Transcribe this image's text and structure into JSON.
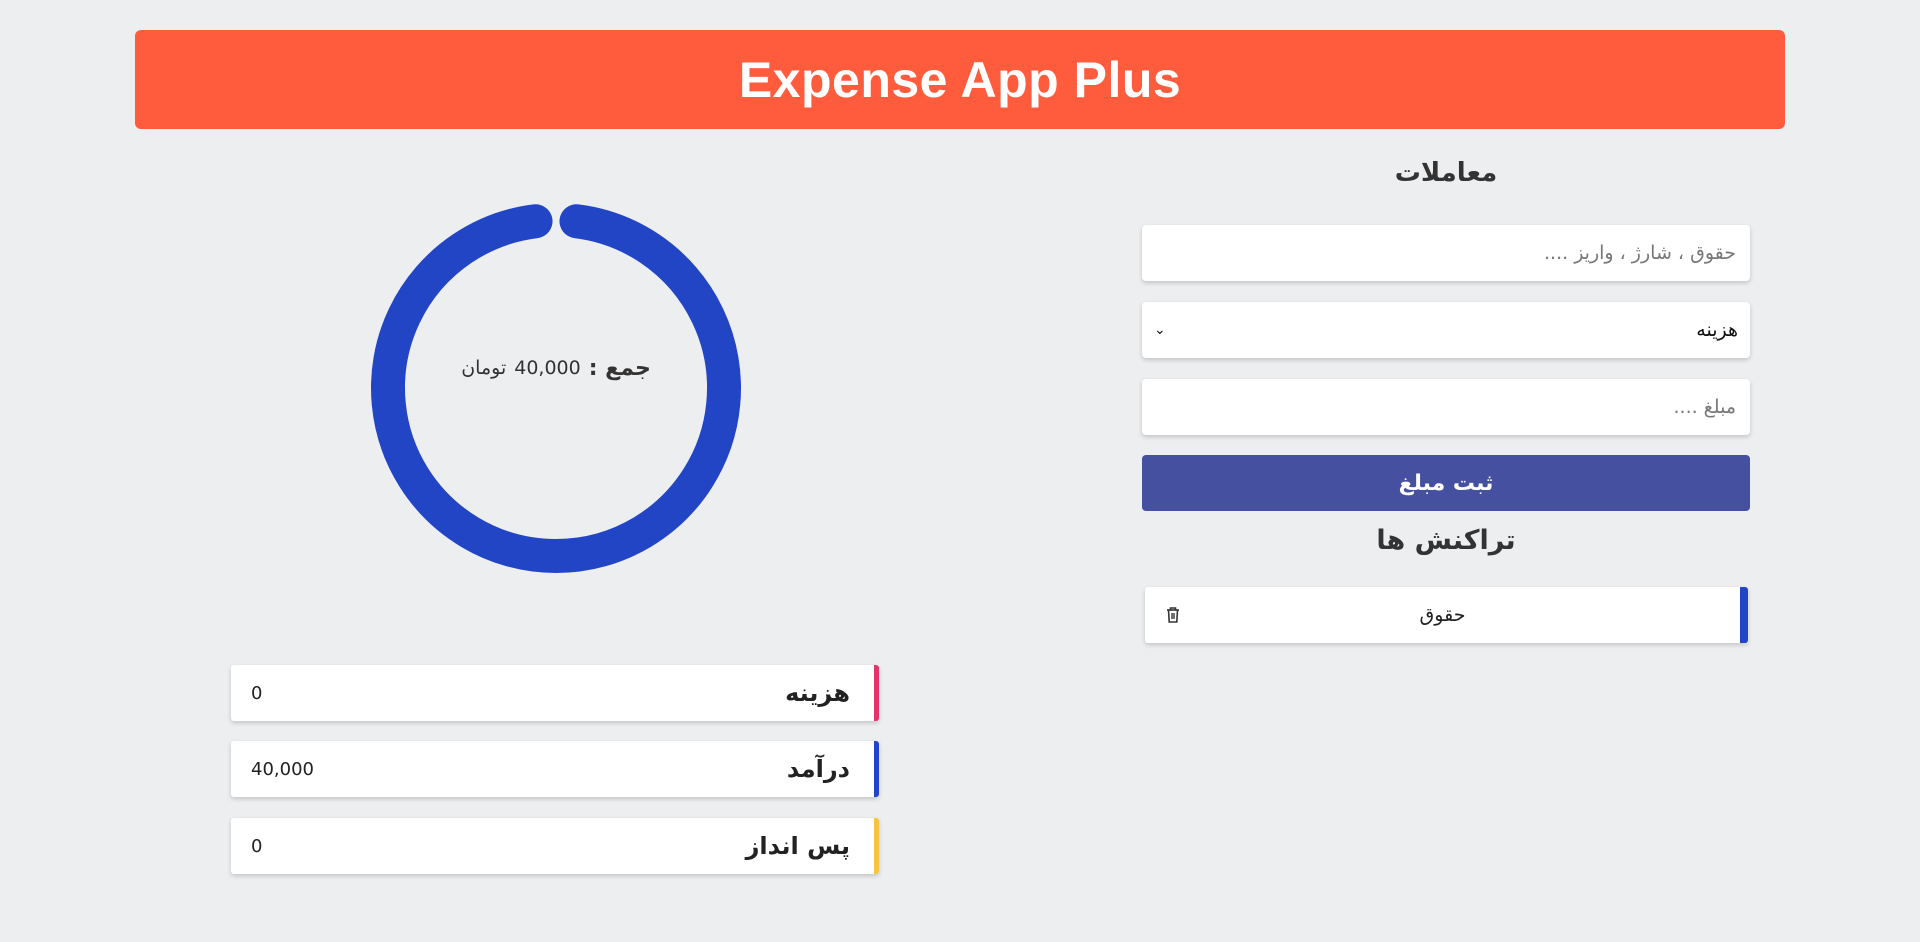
{
  "app": {
    "title": "Expense App Plus"
  },
  "form": {
    "title": "معاملات",
    "description_placeholder": "حقوق ، شارژ ، واریز ....",
    "type_select": {
      "selected": "هزینه",
      "options": [
        "هزینه"
      ]
    },
    "amount_placeholder": "مبلغ ....",
    "submit_label": "ثبت مبلغ"
  },
  "transactions": {
    "title": "تراکنش ها",
    "items": [
      {
        "label": "حقوق",
        "color": "#2245c6"
      }
    ]
  },
  "summary": {
    "total_word": "جمع :",
    "total_amount": "40,000",
    "total_unit": "تومان",
    "stats": [
      {
        "label": "هزینه",
        "value": "0",
        "color": "#e0356a"
      },
      {
        "label": "درآمد",
        "value": "40,000",
        "color": "#2245c6"
      },
      {
        "label": "پس انداز",
        "value": "0",
        "color": "#f5c542"
      }
    ]
  },
  "chart_data": {
    "type": "pie",
    "title": "",
    "categories": [
      "هزینه",
      "درآمد",
      "پس انداز"
    ],
    "values": [
      0,
      40000,
      0
    ],
    "colors": [
      "#e0356a",
      "#2245c6",
      "#f5c542"
    ]
  },
  "colors": {
    "header": "#ff5b3d",
    "button": "#4650a0",
    "background": "#edeef0"
  }
}
